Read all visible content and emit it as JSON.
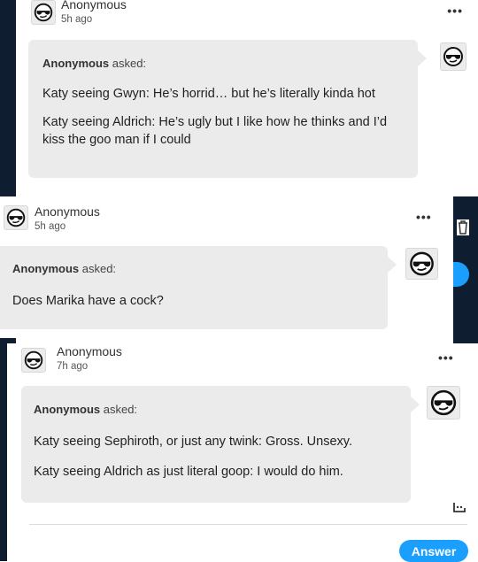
{
  "posts": [
    {
      "author": "Anonymous",
      "time": "5h ago",
      "more": "•••",
      "asker": "Anonymous",
      "asked_suffix": " asked:",
      "lines": [
        "Katy seeing Gwyn: He’s horrid… but he’s literally kinda hot",
        "Katy seeing Aldrich: He’s ugly but I like how he thinks and I’d kiss the goo man if I could"
      ]
    },
    {
      "author": "Anonymous",
      "time": "5h ago",
      "more": "•••",
      "asker": "Anonymous",
      "asked_suffix": " asked:",
      "lines": [
        "Does Marika have a cock?"
      ]
    },
    {
      "author": "Anonymous",
      "time": "7h ago",
      "more": "•••",
      "asker": "Anonymous",
      "asked_suffix": " asked:",
      "lines": [
        "Katy seeing Sephiroth, or just any twink: Gross. Unsexy.",
        "Katy seeing Aldrich as just literal goop: I would do him."
      ]
    }
  ],
  "actions": {
    "answer_label": "Answer"
  },
  "icons": {
    "avatar": "sunglasses-face-icon",
    "trash": "trash-icon",
    "ask": "ask-icon"
  },
  "colors": {
    "navy": "#0f1d30",
    "bubble": "#ebebeb",
    "accent": "#1a9fff"
  }
}
